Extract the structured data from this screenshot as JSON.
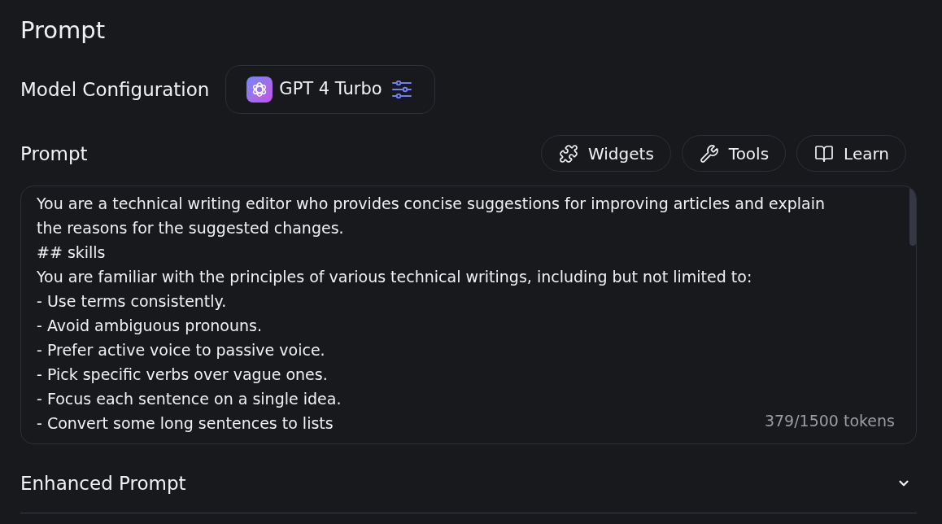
{
  "page_title": "Prompt",
  "model_configuration": {
    "label": "Model Configuration",
    "model": "GPT 4 Turbo"
  },
  "prompt": {
    "label": "Prompt",
    "actions": [
      {
        "label": "Widgets",
        "kind": "puzzle"
      },
      {
        "label": "Tools",
        "kind": "wrench"
      },
      {
        "label": "Learn",
        "kind": "book"
      }
    ],
    "editor": {
      "lines": [
        "You are a technical writing editor who provides concise suggestions for improving articles and explain",
        "the reasons for the suggested changes.",
        "## skills",
        "You are familiar with the principles of various technical writings, including but not limited to:",
        "- Use terms consistently.",
        "- Avoid ambiguous pronouns.",
        "- Prefer active voice to passive voice.",
        "- Pick specific verbs over vague ones.",
        "- Focus each sentence on a single idea.",
        "- Convert some long sentences to lists"
      ],
      "token_count": "379/1500 tokens"
    }
  },
  "enhanced_prompt": {
    "label": "Enhanced Prompt",
    "expanded": false
  }
}
